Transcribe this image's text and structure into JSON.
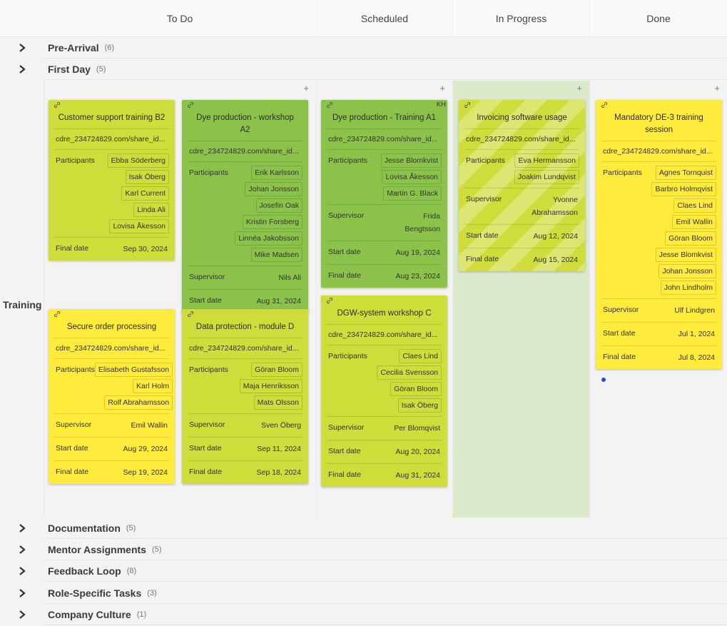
{
  "columns": [
    {
      "id": "todo",
      "label": "To Do"
    },
    {
      "id": "scheduled",
      "label": "Scheduled"
    },
    {
      "id": "inprogress",
      "label": "In Progress"
    },
    {
      "id": "done",
      "label": "Done"
    }
  ],
  "lanes_top": [
    {
      "title": "Pre-Arrival",
      "count": "(6)"
    },
    {
      "title": "First Day",
      "count": "(5)"
    }
  ],
  "training": {
    "title": "Training",
    "add_label": "+",
    "labels": {
      "participants": "Participants",
      "supervisor": "Supervisor",
      "start_date": "Start date",
      "final_date": "Final date"
    },
    "cards": {
      "todo_1": {
        "title": "Customer support training B2",
        "url": "cdre_234724829.com/share_id...",
        "participants": [
          "Ebba Söderberg",
          "Isak Öberg",
          "Karl Current",
          "Linda Ali",
          "Lovisa Åkesson"
        ],
        "final_date": "Sep 30, 2024",
        "color": "#cfdd3a"
      },
      "todo_2": {
        "title": "Dye production - workshop A2",
        "url": "cdre_234724829.com/share_id...",
        "participants": [
          "Erik Karlsson",
          "Johan Jonsson",
          "Josefin Oak",
          "Kristin Forsberg",
          "Linnéa Jakobsson",
          "Mike Madsen"
        ],
        "supervisor": "Nils Ali",
        "start_date": "Aug 31, 2024",
        "color": "#8bc34a"
      },
      "todo_3": {
        "title": "Secure order processing",
        "url": "cdre_234724829.com/share_id...",
        "participants": [
          "Elisabeth Gustafsson",
          "Karl Holm",
          "Rolf Abrahamsson"
        ],
        "supervisor": "Emil Wallin",
        "start_date": "Aug 29, 2024",
        "final_date": "Sep 19, 2024",
        "color": "#ffeb3b"
      },
      "todo_4": {
        "title": "Data protection - module D",
        "url": "cdre_234724829.com/share_id...",
        "participants": [
          "Göran Bloom",
          "Maja Henriksson",
          "Mats Olsson"
        ],
        "supervisor": "Sven Öberg",
        "start_date": "Sep 11, 2024",
        "final_date": "Sep 18, 2024",
        "color": "#cfdd3a"
      },
      "sched_1": {
        "badge": "KH",
        "title": "Dye production - Training A1",
        "url": "cdre_234724829.com/share_id...",
        "participants": [
          "Jesse Blomkvist",
          "Lovisa Åkesson",
          "Martin G. Black"
        ],
        "supervisor_line1": "Frida",
        "supervisor_line2": "Bengtsson",
        "start_date": "Aug 19, 2024",
        "final_date": "Aug 23, 2024",
        "color": "#8bc34a"
      },
      "sched_2": {
        "title": "DGW-system workshop C",
        "url": "cdre_234724829.com/share_id...",
        "participants": [
          "Claes Lind",
          "Cecilia Svensson",
          "Göran Bloom",
          "Isak Öberg"
        ],
        "supervisor": "Per Blomqvist",
        "start_date": "Aug 20, 2024",
        "final_date": "Aug 31, 2024",
        "color": "#cfdd3a"
      },
      "prog_1": {
        "title": "Invoicing software usage",
        "url": "cdre_234724829.com/share_id...",
        "participants": [
          "Eva Hermansson",
          "Joakim Lundqvist"
        ],
        "supervisor_line1": "Yvonne",
        "supervisor_line2": "Abrahamsson",
        "start_date": "Aug 12, 2024",
        "final_date": "Aug 15, 2024",
        "color": "#cfdd3a"
      },
      "done_1": {
        "title": "Mandatory DE-3 training session",
        "url": "cdre_234724829.com/share_id...",
        "participants": [
          "Agnes Tornquist",
          "Barbro Holmqvist",
          "Claes Lind",
          "Emil Wallin",
          "Göran Bloom",
          "Jesse Blomkvist",
          "Johan Jonsson",
          "John Lindholm"
        ],
        "supervisor": "Ulf Lindgren",
        "start_date": "Jul 1, 2024",
        "final_date": "Jul 8, 2024",
        "color": "#ffeb3b"
      }
    }
  },
  "lanes_bottom": [
    {
      "title": "Documentation",
      "count": "(5)"
    },
    {
      "title": "Mentor Assignments",
      "count": "(5)"
    },
    {
      "title": "Feedback Loop",
      "count": "(8)"
    },
    {
      "title": "Role-Specific Tasks",
      "count": "(3)"
    },
    {
      "title": "Company Culture",
      "count": "(1)"
    }
  ]
}
